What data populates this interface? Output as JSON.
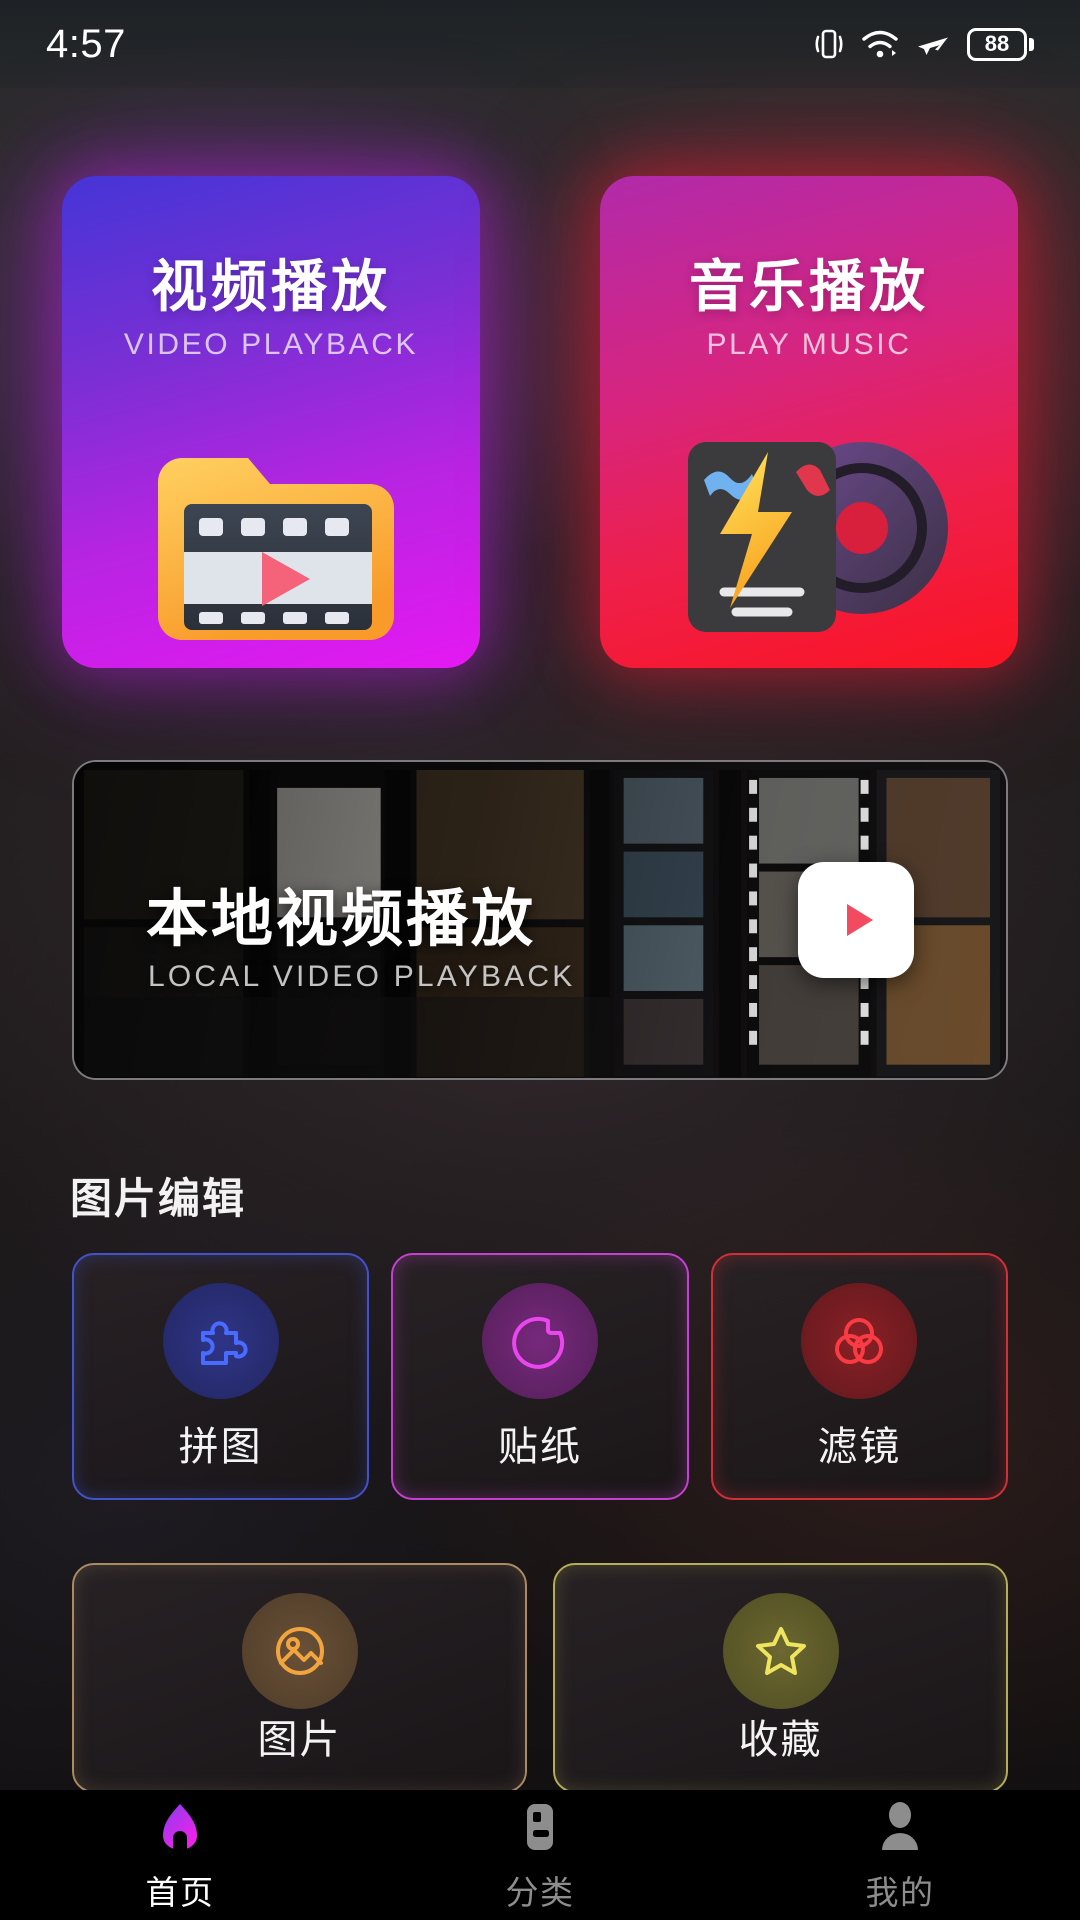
{
  "status_bar": {
    "time": "4:57",
    "icons": [
      "vibrate-icon",
      "wifi-icon",
      "airplane-mode-icon"
    ],
    "battery_level": "88"
  },
  "top_cards": [
    {
      "title": "视频播放",
      "subtitle": "VIDEO PLAYBACK",
      "icon": "video-folder-icon",
      "gradient_from": "#4535d6",
      "gradient_to": "#e519f2"
    },
    {
      "title": "音乐播放",
      "subtitle": "PLAY MUSIC",
      "icon": "music-vinyl-icon",
      "gradient_from": "#b12aaa",
      "gradient_to": "#fb1422"
    }
  ],
  "banner": {
    "title": "本地视频播放",
    "subtitle": "LOCAL VIDEO PLAYBACK",
    "play_icon": "play-icon"
  },
  "section": {
    "title": "图片编辑"
  },
  "tiles_row1": [
    {
      "label": "拼图",
      "icon": "puzzle-icon",
      "accent": "#3f63f5",
      "bubble": "#2b2f7a",
      "border": "#4352c9"
    },
    {
      "label": "贴纸",
      "icon": "sticker-icon",
      "accent": "#e13ce8",
      "bubble": "#6b2a70",
      "border": "#c440cf"
    },
    {
      "label": "滤镜",
      "icon": "filter-icon",
      "accent": "#f0303a",
      "bubble": "#7a1d22",
      "border": "#d03038"
    }
  ],
  "tiles_row2": [
    {
      "label": "图片",
      "icon": "photo-icon",
      "accent": "#f0a23c",
      "bubble": "#5e4428",
      "border": "#a98a63"
    },
    {
      "label": "收藏",
      "icon": "star-icon",
      "accent": "#ece15a",
      "bubble": "#5d5a2a",
      "border": "#b5ae57"
    }
  ],
  "bottom_nav": [
    {
      "label": "首页",
      "icon": "home-icon",
      "active": true
    },
    {
      "label": "分类",
      "icon": "categories-icon",
      "active": false
    },
    {
      "label": "我的",
      "icon": "profile-icon",
      "active": false
    }
  ],
  "colors": {
    "accent_magenta": "#e519f2",
    "accent_red": "#fb1422",
    "nav_active": "#ffffff",
    "nav_inactive": "#8d8d8d"
  }
}
